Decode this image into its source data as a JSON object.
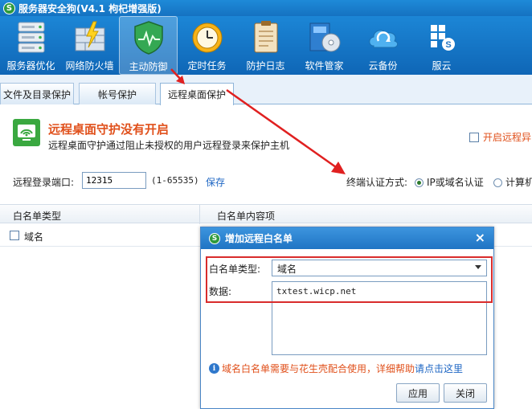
{
  "app": {
    "title": "服务器安全狗(V4.1 枸杞增强版)",
    "logo_letter": "S"
  },
  "toolbar": {
    "items": [
      {
        "label": "服务器优化",
        "icon": "server-icon"
      },
      {
        "label": "网络防火墙",
        "icon": "firewall-icon"
      },
      {
        "label": "主动防御",
        "icon": "shield-icon",
        "active": true
      },
      {
        "label": "定时任务",
        "icon": "clock-icon"
      },
      {
        "label": "防护日志",
        "icon": "log-icon"
      },
      {
        "label": "软件管家",
        "icon": "software-icon"
      },
      {
        "label": "云备份",
        "icon": "cloud-icon"
      },
      {
        "label": "服云",
        "icon": "cloud-service-icon"
      }
    ]
  },
  "tabs": [
    {
      "label": "文件及目录保护"
    },
    {
      "label": "帐号保护"
    },
    {
      "label": "远程桌面保护",
      "active": true
    }
  ],
  "status": {
    "title": "远程桌面守护没有开启",
    "description": "远程桌面守护通过阻止未授权的用户远程登录来保护主机",
    "alert_checkbox_label": "开启远程异"
  },
  "port": {
    "label": "远程登录端口:",
    "value": "12315",
    "range": "(1-65535)",
    "save_label": "保存"
  },
  "auth": {
    "label": "终端认证方式:",
    "option1": "IP或域名认证",
    "option2": "计算机",
    "selected": "option1"
  },
  "list": {
    "col1": "白名单类型",
    "col2": "白名单内容项",
    "rows": [
      {
        "type": "域名"
      }
    ]
  },
  "dialog": {
    "title": "增加远程白名单",
    "close_glyph": "×",
    "type_label": "白名单类型:",
    "type_value": "域名",
    "data_label": "数据:",
    "data_value": "txtest.wicp.net",
    "info_text": "域名白名单需要与花生壳配合使用，详细帮助",
    "help_link": "请点击这里",
    "info_glyph": "i",
    "apply_label": "应用",
    "close_label": "关闭"
  },
  "colors": {
    "accent": "#1f74c4",
    "warning_text": "#e0501b",
    "highlight": "#d92c2c"
  }
}
